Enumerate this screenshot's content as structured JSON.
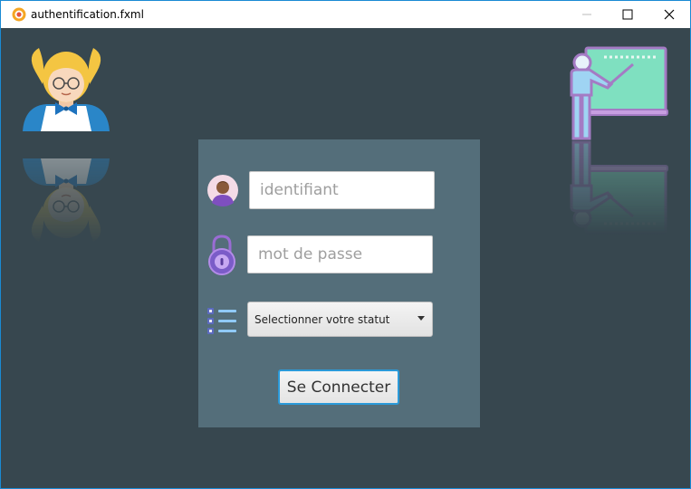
{
  "window": {
    "title": "authentification.fxml",
    "controls": {
      "minimize": "—",
      "maximize": "☐",
      "close": "✕"
    }
  },
  "icons": {
    "app": "app-logo-icon",
    "user": "user-avatar-icon",
    "password": "padlock-icon",
    "status": "list-icon",
    "left_illustration": "student-girl-icon",
    "right_illustration": "teacher-board-icon"
  },
  "form": {
    "username_placeholder": "identifiant",
    "password_placeholder": "mot de passe",
    "status_select": "Selectionner votre statut",
    "submit_label": "Se Connecter"
  },
  "colors": {
    "background": "#37474f",
    "panel": "#546e7a",
    "accent": "#2b9ad9"
  }
}
